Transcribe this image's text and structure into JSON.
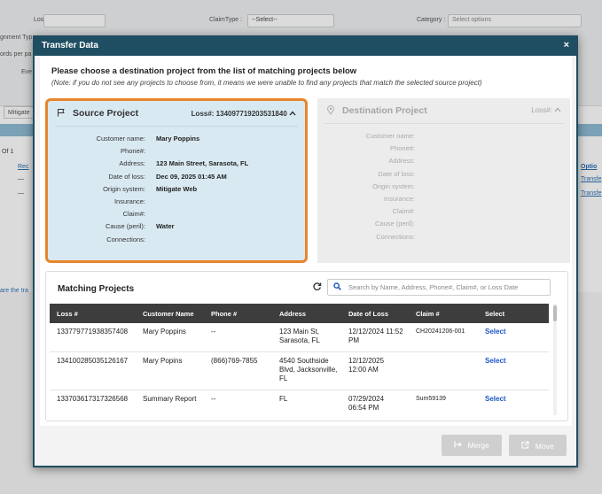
{
  "background": {
    "loss_label": "Loss# :",
    "claimtype_label": "ClaimType :",
    "claimtype_value": "--Select--",
    "category_label": "Category :",
    "category_placeholder": "Select options",
    "assignment_label": "gnment Typ",
    "cards_label": "ords per pa",
    "eve_label": "Eve",
    "tab_label": "Mitigate",
    "page_label": "Of 1",
    "rec_link": "Rec",
    "options_link": "Optio",
    "transfer_link1": "Transfe",
    "transfer_link2": "Transfe",
    "share_link": "are the tra",
    "dash1": "—",
    "dash2": "—"
  },
  "modal": {
    "title": "Transfer Data",
    "close_glyph": "×",
    "instruction": "Please choose a destination project from the list of matching projects below",
    "note": "(Note: if you do not see any projects to choose from, it means we were unable to find any projects that match the selected source project)"
  },
  "source": {
    "title": "Source Project",
    "loss_label": "Loss#: 134097719203531840",
    "chevron": "‸",
    "fields": [
      {
        "label": "Customer name:",
        "value": "Mary Poppins"
      },
      {
        "label": "Phone#:",
        "value": ""
      },
      {
        "label": "Address:",
        "value": "123 Main Street, Sarasota, FL"
      },
      {
        "label": "Date of loss:",
        "value": "Dec 09, 2025 01:45 AM"
      },
      {
        "label": "Origin system:",
        "value": "Mitigate Web"
      },
      {
        "label": "Insurance:",
        "value": ""
      },
      {
        "label": "Claim#:",
        "value": ""
      },
      {
        "label": "Cause (peril):",
        "value": "Water"
      },
      {
        "label": "Connections:",
        "value": ""
      }
    ]
  },
  "destination": {
    "title": "Destination Project",
    "loss_label": "Loss#:",
    "fields": [
      {
        "label": "Customer name:"
      },
      {
        "label": "Phone#:"
      },
      {
        "label": "Address:"
      },
      {
        "label": "Date of loss:"
      },
      {
        "label": "Origin system:"
      },
      {
        "label": "Insurance:"
      },
      {
        "label": "Claim#:"
      },
      {
        "label": "Cause (peril):"
      },
      {
        "label": "Connections:"
      }
    ]
  },
  "matching": {
    "title": "Matching Projects",
    "search_placeholder": "Search by Name, Address, Phone#, Claim#, or Loss Date",
    "columns": [
      "Loss #",
      "Customer Name",
      "Phone #",
      "Address",
      "Date of Loss",
      "Claim #",
      "Select"
    ],
    "rows": [
      {
        "loss": "133779771938357408",
        "name": "Mary Poppins",
        "phone": "--",
        "address": "123 Main St, Sarasota, FL",
        "date": "12/12/2024 11:52 PM",
        "claim": "CH20241206-001",
        "select": "Select"
      },
      {
        "loss": "134100285035126167",
        "name": "Mary Popins",
        "phone": "(866)769-7855",
        "address": "4540 Southside Blvd, Jacksonville, FL",
        "date": "12/12/2025 12:00 AM",
        "claim": "",
        "select": "Select"
      },
      {
        "loss": "133703617317326568",
        "name": "Summary Report",
        "phone": "--",
        "address": "FL",
        "date": "07/29/2024 06:54 PM",
        "claim": "Sum59139",
        "select": "Select"
      }
    ]
  },
  "footer": {
    "merge_label": "Merge",
    "move_label": "Move"
  }
}
